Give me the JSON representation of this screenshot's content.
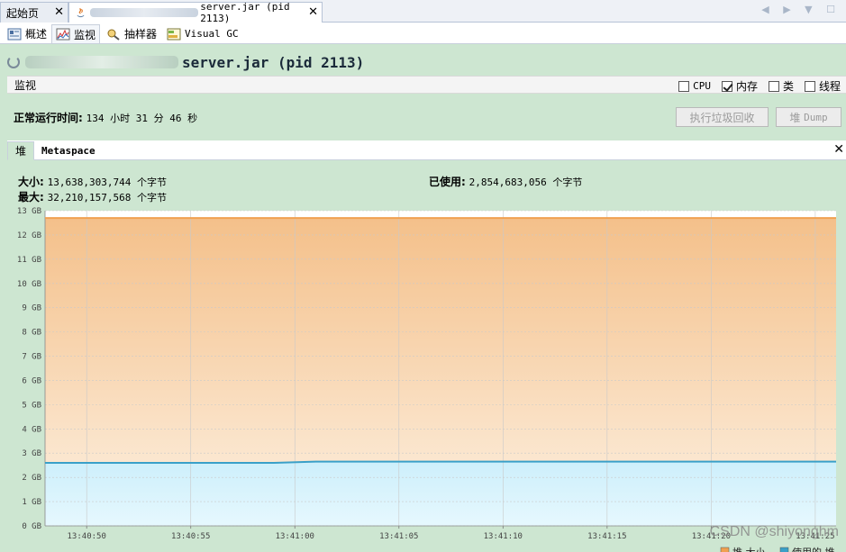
{
  "window": {
    "tabs": [
      {
        "label": "起始页",
        "close": "✕"
      },
      {
        "label_suffix": "server.jar (pid 2113)",
        "close": "✕"
      }
    ],
    "nav_arrows": "◀ ▶ ▼ ☐"
  },
  "subtabs": [
    {
      "label": "概述"
    },
    {
      "label": "监视"
    },
    {
      "label": "抽样器"
    },
    {
      "label": "Visual GC"
    }
  ],
  "header": {
    "title_suffix": "server.jar (pid 2113)"
  },
  "monitor": {
    "label": "监视",
    "checkboxes": [
      {
        "label": "CPU",
        "checked": false
      },
      {
        "label": "内存",
        "checked": true
      },
      {
        "label": "类",
        "checked": false
      },
      {
        "label": "线程",
        "checked": false
      }
    ]
  },
  "uptime": {
    "label": "正常运行时间:",
    "value": "134 小时 31 分 46 秒"
  },
  "buttons": {
    "gc": "执行垃圾回收",
    "dump_prefix": "堆",
    "dump_suffix": "Dump"
  },
  "heap_tabs": {
    "heap": "堆",
    "metaspace": "Metaspace",
    "close": "✕"
  },
  "heap_stats": {
    "size_label": "大小:",
    "size_value": "13,638,303,744 个字节",
    "max_label": "最大:",
    "max_value": "32,210,157,568 个字节",
    "used_label": "已使用:",
    "used_value": "2,854,683,056 个字节"
  },
  "chart_data": {
    "type": "area",
    "y_ticks": [
      "0 GB",
      "1 GB",
      "2 GB",
      "3 GB",
      "4 GB",
      "5 GB",
      "6 GB",
      "7 GB",
      "8 GB",
      "9 GB",
      "10 GB",
      "11 GB",
      "12 GB",
      "13 GB"
    ],
    "ylim": [
      0,
      13
    ],
    "x_ticks": [
      "13:40:50",
      "13:40:55",
      "13:41:00",
      "13:41:05",
      "13:41:10",
      "13:41:15",
      "13:41:20",
      "13:41:25"
    ],
    "series": [
      {
        "name": "堆 大小",
        "color": "#f0a050",
        "x": [
          "13:40:48",
          "13:41:26"
        ],
        "values": [
          12.7,
          12.7
        ]
      },
      {
        "name": "使用的 堆",
        "color": "#3aa0c8",
        "x": [
          "13:40:48",
          "13:40:59",
          "13:41:01",
          "13:41:26"
        ],
        "values": [
          2.6,
          2.6,
          2.65,
          2.65
        ]
      }
    ],
    "legend": [
      "堆 大小",
      "使用的 堆"
    ],
    "grid": true
  },
  "watermark": "CSDN @shiyonghm"
}
